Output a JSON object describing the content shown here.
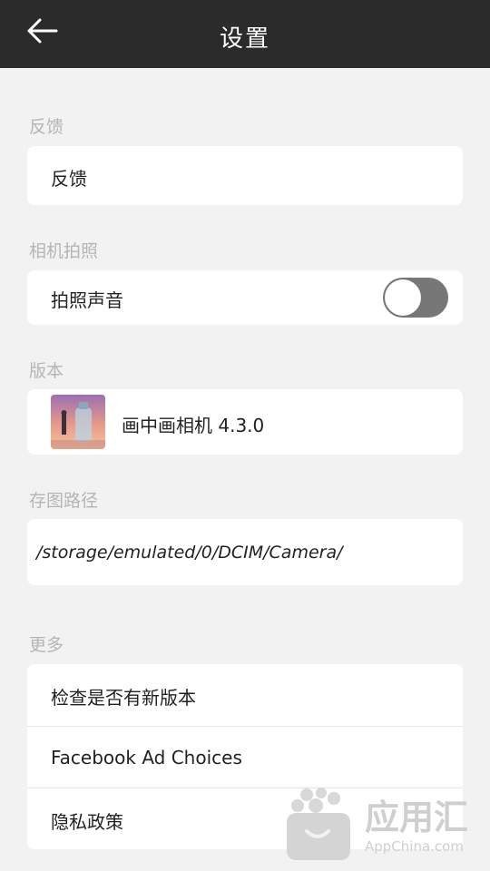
{
  "header": {
    "title": "设置",
    "back_icon": "arrow-left-icon"
  },
  "sections": {
    "feedback": {
      "label": "反馈",
      "item": "反馈"
    },
    "camera": {
      "label": "相机拍照",
      "item": "拍照声音",
      "toggle_on": false
    },
    "version": {
      "label": "版本",
      "app_name": "画中画相机 4.3.0"
    },
    "storage": {
      "label": "存图路径",
      "path": "/storage/emulated/0/DCIM/Camera/"
    },
    "more": {
      "label": "更多",
      "items": [
        "检查是否有新版本",
        "Facebook Ad Choices",
        "隐私政策"
      ]
    }
  },
  "watermark": {
    "big": "应用汇",
    "small": "AppChina.com"
  },
  "colors": {
    "topbar": "#2b2b2b",
    "background": "#f2f2f2",
    "toggle_off": "#777777"
  }
}
